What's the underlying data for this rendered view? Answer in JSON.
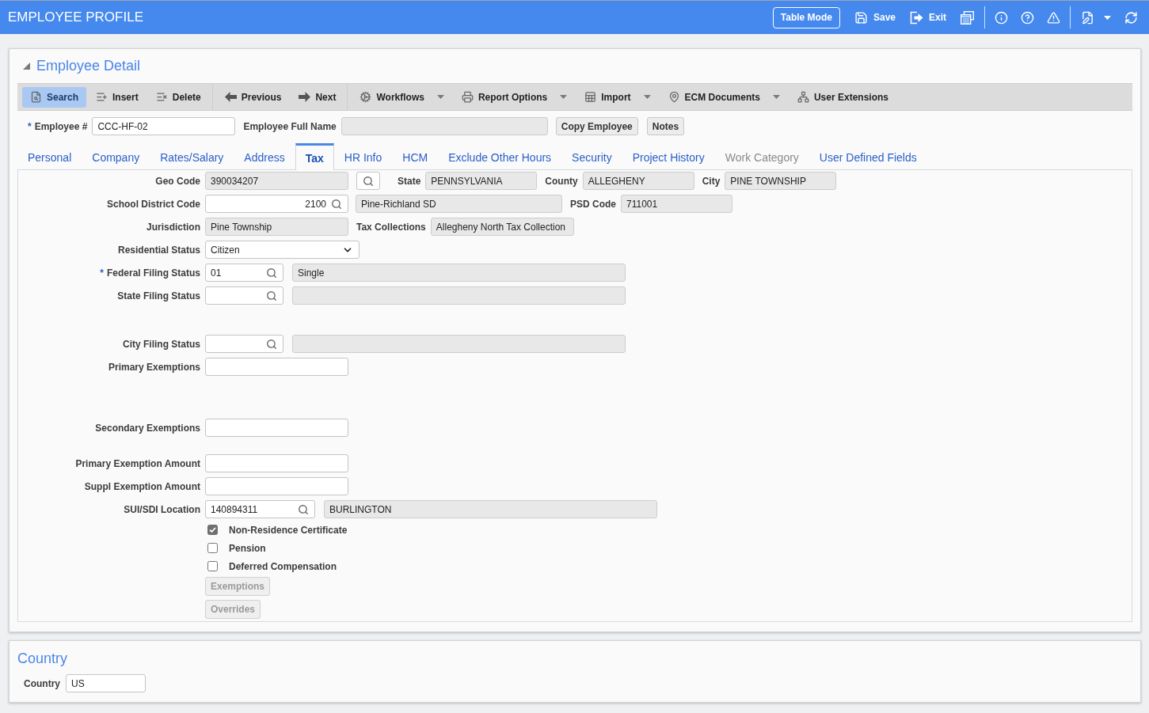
{
  "window": {
    "title": "EMPLOYEE PROFILE"
  },
  "header_actions": [
    {
      "kind": "outlined",
      "label": "Table Mode"
    },
    {
      "kind": "icon_label",
      "label": "Save"
    },
    {
      "kind": "icon_label",
      "label": "Exit"
    }
  ],
  "employee_detail": {
    "title": "Employee Detail",
    "expanded": true,
    "toolbar": {
      "groups": [
        {
          "items": [
            {
              "label": "Search",
              "selected": true,
              "dropdown": false
            },
            {
              "label": "Insert",
              "selected": false,
              "dropdown": false
            },
            {
              "label": "Delete",
              "selected": false,
              "dropdown": false
            }
          ]
        },
        {
          "items": [
            {
              "label": "Previous",
              "selected": false,
              "dropdown": false
            },
            {
              "label": "Next",
              "selected": false,
              "dropdown": false
            }
          ]
        },
        {
          "items": [
            {
              "label": "Workflows",
              "selected": false,
              "dropdown": true
            },
            {
              "label": "Report Options",
              "selected": false,
              "dropdown": true
            },
            {
              "label": "Import",
              "selected": false,
              "dropdown": true
            },
            {
              "label": "ECM Documents",
              "selected": false,
              "dropdown": true
            },
            {
              "label": "User Extensions",
              "selected": false,
              "dropdown": false
            }
          ]
        }
      ]
    },
    "employee_number": {
      "required_mark": "*",
      "label": "Employee #",
      "value": "CCC-HF-02",
      "disabled": false
    },
    "employee_full_name": {
      "label": "Employee Full Name",
      "disabled": true
    },
    "buttons": [
      {
        "label": "Copy Employee"
      },
      {
        "label": "Notes"
      }
    ],
    "tabs": [
      {
        "label": "Personal",
        "selected": false,
        "disabled": false
      },
      {
        "label": "Company",
        "selected": false,
        "disabled": false
      },
      {
        "label": "Rates/Salary",
        "selected": false,
        "disabled": false
      },
      {
        "label": "Address",
        "selected": false,
        "disabled": false
      },
      {
        "label": "Tax",
        "selected": true,
        "disabled": false
      },
      {
        "label": "HR Info",
        "selected": false,
        "disabled": false
      },
      {
        "label": "HCM",
        "selected": false,
        "disabled": false
      },
      {
        "label": "Exclude Other Hours",
        "selected": false,
        "disabled": false
      },
      {
        "label": "Security",
        "selected": false,
        "disabled": false
      },
      {
        "label": "Project History",
        "selected": false,
        "disabled": false
      },
      {
        "label": "Work Category",
        "selected": false,
        "disabled": true
      },
      {
        "label": "User Defined Fields",
        "selected": false,
        "disabled": false
      }
    ],
    "tax": {
      "geo_code": {
        "label": "Geo Code",
        "value": "390034207",
        "disabled": true
      },
      "state": {
        "label": "State",
        "value": "PENNSYLVANIA",
        "disabled": true
      },
      "county": {
        "label": "County",
        "value": "ALLEGHENY",
        "disabled": true
      },
      "city": {
        "label": "City",
        "value": "PINE TOWNSHIP",
        "disabled": true
      },
      "school_district_code": {
        "label": "School District Code",
        "value": "2100",
        "disabled": false,
        "description": "Pine-Richland SD"
      },
      "psd_code": {
        "label": "PSD Code",
        "value": "711001",
        "disabled": true
      },
      "jurisdiction": {
        "label": "Jurisdiction",
        "value": "Pine Township",
        "disabled": true
      },
      "tax_collections": {
        "label": "Tax Collections",
        "value": "Allegheny North Tax Collection",
        "disabled": true
      },
      "residential_status": {
        "label": "Residential Status",
        "value": "Citizen"
      },
      "federal_filing_status": {
        "required_mark": "*",
        "label": "Federal Filing Status",
        "value": "01",
        "disabled": false,
        "description": "Single"
      },
      "state_filing_status": {
        "label": "State Filing Status",
        "disabled": false
      },
      "city_filing_status": {
        "label": "City Filing Status",
        "disabled": false
      },
      "primary_exemptions": {
        "label": "Primary Exemptions",
        "disabled": false
      },
      "secondary_exemptions": {
        "label": "Secondary Exemptions",
        "disabled": false
      },
      "primary_exemption_amount": {
        "label": "Primary Exemption Amount",
        "disabled": false
      },
      "suppl_exemption_amount": {
        "label": "Suppl Exemption Amount",
        "disabled": false
      },
      "sui_sdi_location": {
        "label": "SUI/SDI Location",
        "value": "140894311",
        "disabled": false,
        "description": "BURLINGTON"
      },
      "checkboxes": [
        {
          "label": "Non-Residence Certificate",
          "checked": true
        },
        {
          "label": "Pension",
          "checked": false
        },
        {
          "label": "Deferred Compensation",
          "checked": false
        }
      ],
      "buttons": [
        {
          "label": "Exemptions",
          "disabled": true
        },
        {
          "label": "Overrides",
          "disabled": true
        }
      ]
    }
  },
  "country_section": {
    "title": "Country",
    "country": {
      "label": "Country",
      "value": "US",
      "disabled": false
    }
  }
}
